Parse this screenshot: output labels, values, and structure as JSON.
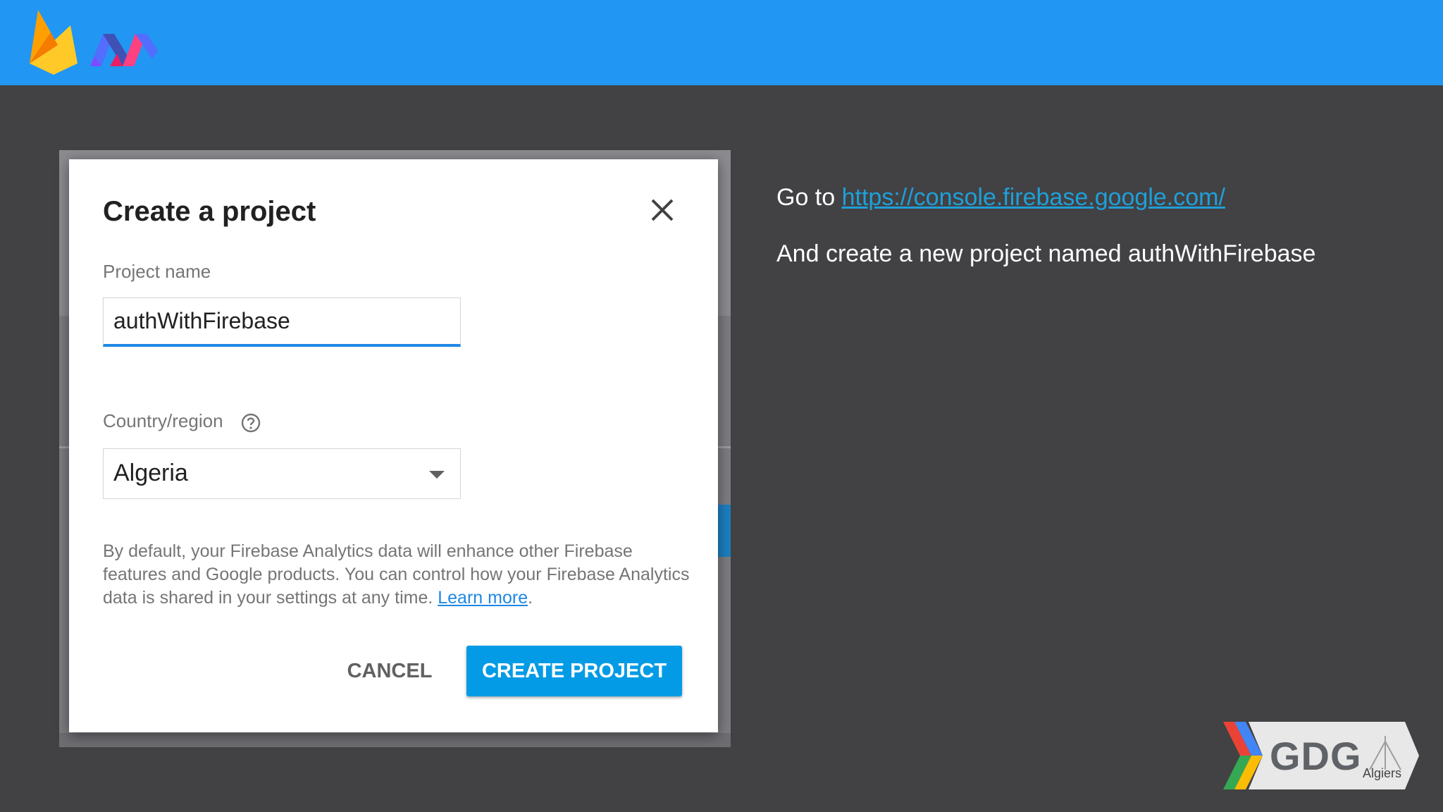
{
  "dialog": {
    "title": "Create a project",
    "project_name_label": "Project name",
    "project_name_value": "authWithFirebase",
    "country_label": "Country/region",
    "country_value": "Algeria",
    "disclaimer_text": "By default, your Firebase Analytics data will enhance other Firebase features and Google products. You can control how your Firebase Analytics data is shared in your settings at any time. ",
    "learn_more": "Learn more",
    "disclaimer_end": ".",
    "cancel_label": "CANCEL",
    "create_label": "CREATE PROJECT"
  },
  "instructions": {
    "line1_prefix": "Go to ",
    "line1_link": "https://console.firebase.google.com/",
    "line2": "And create a new project named authWithFirebase"
  },
  "badge": {
    "text": "GDG",
    "sub": "Algiers"
  },
  "colors": {
    "header": "#2196f3",
    "background": "#424144",
    "primary_button": "#039be5",
    "link": "#1e88e5"
  },
  "icons": {
    "logo1": "firebase-logo",
    "logo2": "polymer-logo",
    "close": "close-icon",
    "help": "help-icon",
    "dropdown": "chevron-down-icon"
  }
}
